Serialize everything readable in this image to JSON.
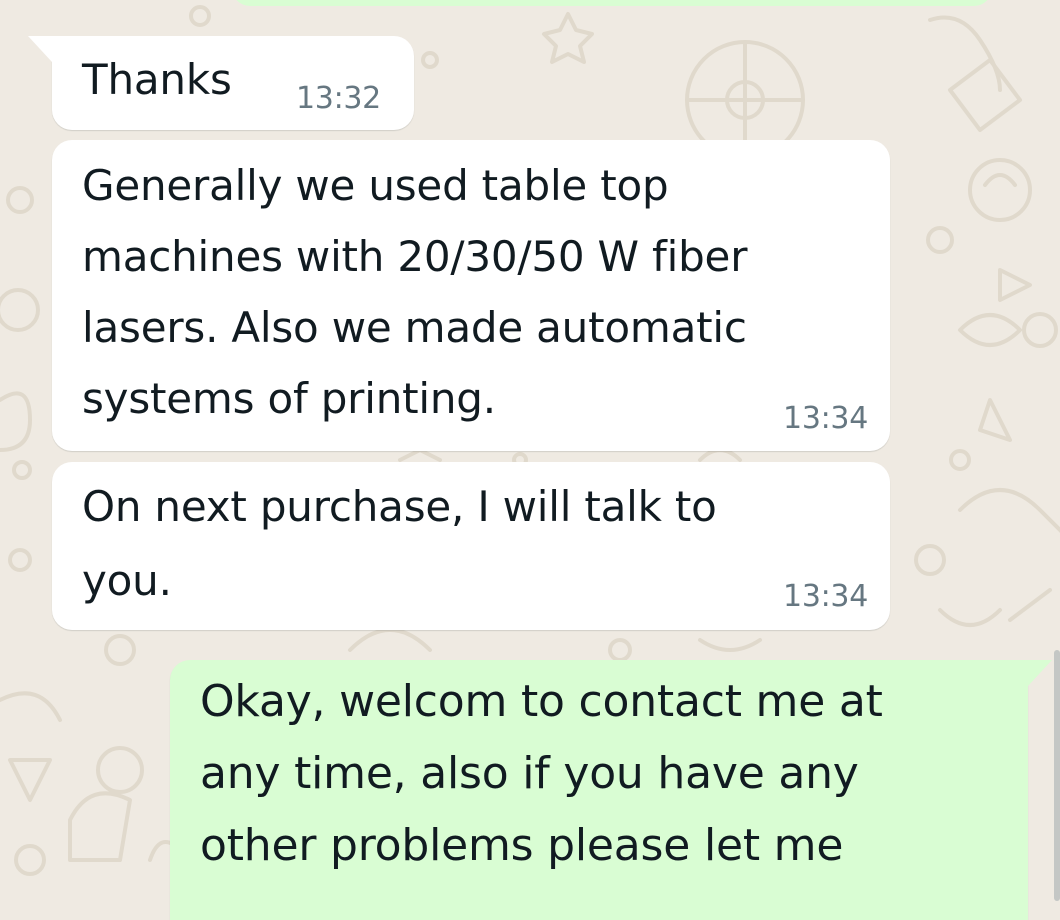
{
  "colors": {
    "wallpaper": "#efeae2",
    "wallpaper_doodle": "#e2dccf",
    "incoming_bubble": "#ffffff",
    "outgoing_bubble": "#d9fdd3",
    "text": "#111b21",
    "timestamp": "#667781"
  },
  "messages": [
    {
      "direction": "incoming",
      "text": "Thanks",
      "time": "13:32"
    },
    {
      "direction": "incoming",
      "text": "Generally we used table top\nmachines with 20/30/50 W fiber\nlasers. Also we made automatic\nsystems of printing.",
      "time": "13:34"
    },
    {
      "direction": "incoming",
      "text": "On next purchase, I will talk to\nyou.",
      "time": "13:34"
    },
    {
      "direction": "outgoing",
      "text": "Okay, welcom to contact me at\nany time, also if you have any\nother problems please let me"
    }
  ]
}
